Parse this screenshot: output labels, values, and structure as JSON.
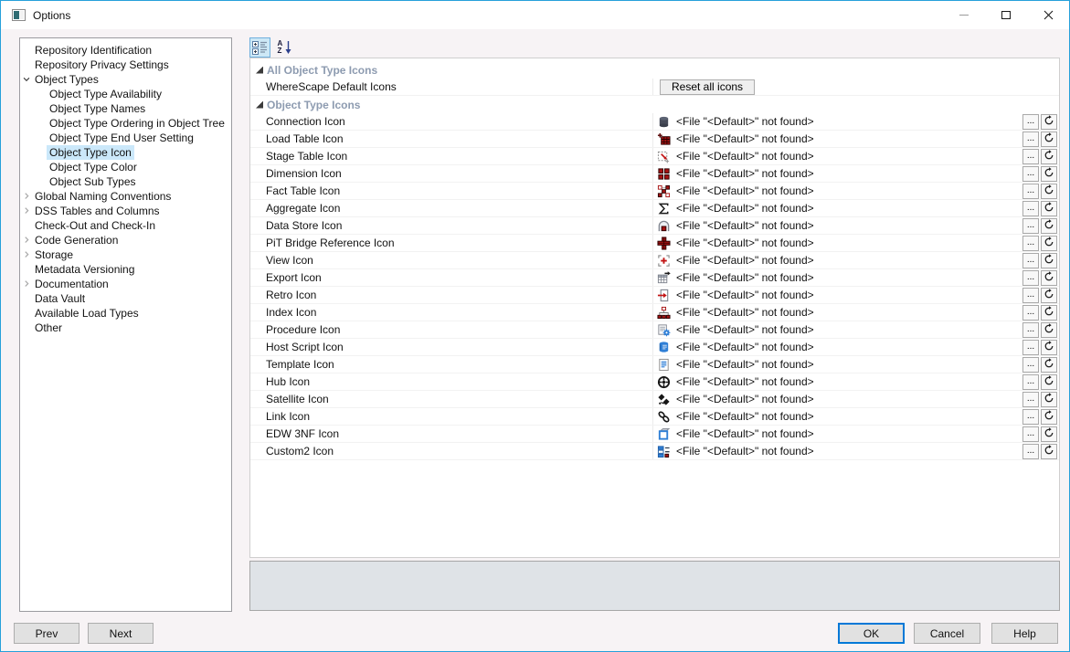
{
  "window": {
    "title": "Options",
    "controls": {
      "minimize": "minimize",
      "maximize": "maximize",
      "close": "close"
    }
  },
  "colors": {
    "window_border": "#26a0da",
    "accent": "#0078d7",
    "tree_selection": "#cbe8fa",
    "category_text": "#8d9bb0",
    "description_panel_bg": "#dfe3e7",
    "icon_red": "#a61313",
    "icon_blue": "#2f7fd6"
  },
  "sidebar": {
    "items": [
      {
        "label": "Repository Identification",
        "level": 0,
        "chevron": null,
        "selected": false
      },
      {
        "label": "Repository Privacy Settings",
        "level": 0,
        "chevron": null,
        "selected": false
      },
      {
        "label": "Object Types",
        "level": 0,
        "chevron": "expanded",
        "selected": false
      },
      {
        "label": "Object Type Availability",
        "level": 1,
        "chevron": null,
        "selected": false
      },
      {
        "label": "Object Type Names",
        "level": 1,
        "chevron": null,
        "selected": false
      },
      {
        "label": "Object Type Ordering in Object Tree",
        "level": 1,
        "chevron": null,
        "selected": false
      },
      {
        "label": "Object Type End User Setting",
        "level": 1,
        "chevron": null,
        "selected": false
      },
      {
        "label": "Object Type Icon",
        "level": 1,
        "chevron": null,
        "selected": true
      },
      {
        "label": "Object Type Color",
        "level": 1,
        "chevron": null,
        "selected": false
      },
      {
        "label": "Object Sub Types",
        "level": 1,
        "chevron": null,
        "selected": false
      },
      {
        "label": "Global Naming Conventions",
        "level": 0,
        "chevron": "collapsed",
        "selected": false
      },
      {
        "label": "DSS Tables and Columns",
        "level": 0,
        "chevron": "collapsed",
        "selected": false
      },
      {
        "label": "Check-Out and Check-In",
        "level": 0,
        "chevron": null,
        "selected": false
      },
      {
        "label": "Code Generation",
        "level": 0,
        "chevron": "collapsed",
        "selected": false
      },
      {
        "label": "Storage",
        "level": 0,
        "chevron": "collapsed",
        "selected": false
      },
      {
        "label": "Metadata Versioning",
        "level": 0,
        "chevron": null,
        "selected": false
      },
      {
        "label": "Documentation",
        "level": 0,
        "chevron": "collapsed",
        "selected": false
      },
      {
        "label": "Data Vault",
        "level": 0,
        "chevron": null,
        "selected": false
      },
      {
        "label": "Available Load Types",
        "level": 0,
        "chevron": null,
        "selected": false
      },
      {
        "label": "Other",
        "level": 0,
        "chevron": null,
        "selected": false
      }
    ]
  },
  "toolbar": {
    "buttons": [
      {
        "name": "categorized-view-icon",
        "selected": true
      },
      {
        "name": "sort-alphabetical-icon",
        "selected": false,
        "letter_a": "A",
        "letter_z": "Z"
      }
    ]
  },
  "property_grid": {
    "browse_label": "...",
    "sections": [
      {
        "title": "All Object Type Icons",
        "rows": [
          {
            "label": "WhereScape Default Icons",
            "type": "action",
            "button_label": "Reset all icons"
          }
        ]
      },
      {
        "title": "Object Type Icons",
        "rows": [
          {
            "label": "Connection Icon",
            "icon": "database-icon",
            "value": "<File \"<Default>\" not found>"
          },
          {
            "label": "Load Table Icon",
            "icon": "load-table-icon",
            "value": "<File \"<Default>\" not found>"
          },
          {
            "label": "Stage Table Icon",
            "icon": "stage-table-icon",
            "value": "<File \"<Default>\" not found>"
          },
          {
            "label": "Dimension Icon",
            "icon": "dimension-icon",
            "value": "<File \"<Default>\" not found>"
          },
          {
            "label": "Fact Table Icon",
            "icon": "fact-table-icon",
            "value": "<File \"<Default>\" not found>"
          },
          {
            "label": "Aggregate Icon",
            "icon": "aggregate-sigma-icon",
            "value": "<File \"<Default>\" not found>"
          },
          {
            "label": "Data Store Icon",
            "icon": "data-store-icon",
            "value": "<File \"<Default>\" not found>"
          },
          {
            "label": "PiT Bridge Reference Icon",
            "icon": "pit-bridge-icon",
            "value": "<File \"<Default>\" not found>"
          },
          {
            "label": "View Icon",
            "icon": "view-icon",
            "value": "<File \"<Default>\" not found>"
          },
          {
            "label": "Export Icon",
            "icon": "export-icon",
            "value": "<File \"<Default>\" not found>"
          },
          {
            "label": "Retro Icon",
            "icon": "retro-icon",
            "value": "<File \"<Default>\" not found>"
          },
          {
            "label": "Index Icon",
            "icon": "index-icon",
            "value": "<File \"<Default>\" not found>"
          },
          {
            "label": "Procedure Icon",
            "icon": "procedure-icon",
            "value": "<File \"<Default>\" not found>"
          },
          {
            "label": "Host Script Icon",
            "icon": "host-script-icon",
            "value": "<File \"<Default>\" not found>"
          },
          {
            "label": "Template Icon",
            "icon": "template-icon",
            "value": "<File \"<Default>\" not found>"
          },
          {
            "label": "Hub Icon",
            "icon": "hub-icon",
            "value": "<File \"<Default>\" not found>"
          },
          {
            "label": "Satellite Icon",
            "icon": "satellite-icon",
            "value": "<File \"<Default>\" not found>"
          },
          {
            "label": "Link Icon",
            "icon": "link-icon",
            "value": "<File \"<Default>\" not found>"
          },
          {
            "label": "EDW 3NF Icon",
            "icon": "edw-3nf-icon",
            "value": "<File \"<Default>\" not found>"
          },
          {
            "label": "Custom2 Icon",
            "icon": "custom2-icon",
            "value": "<File \"<Default>\" not found>"
          }
        ]
      }
    ]
  },
  "footer": {
    "prev": "Prev",
    "next": "Next",
    "ok": "OK",
    "cancel": "Cancel",
    "help": "Help"
  }
}
